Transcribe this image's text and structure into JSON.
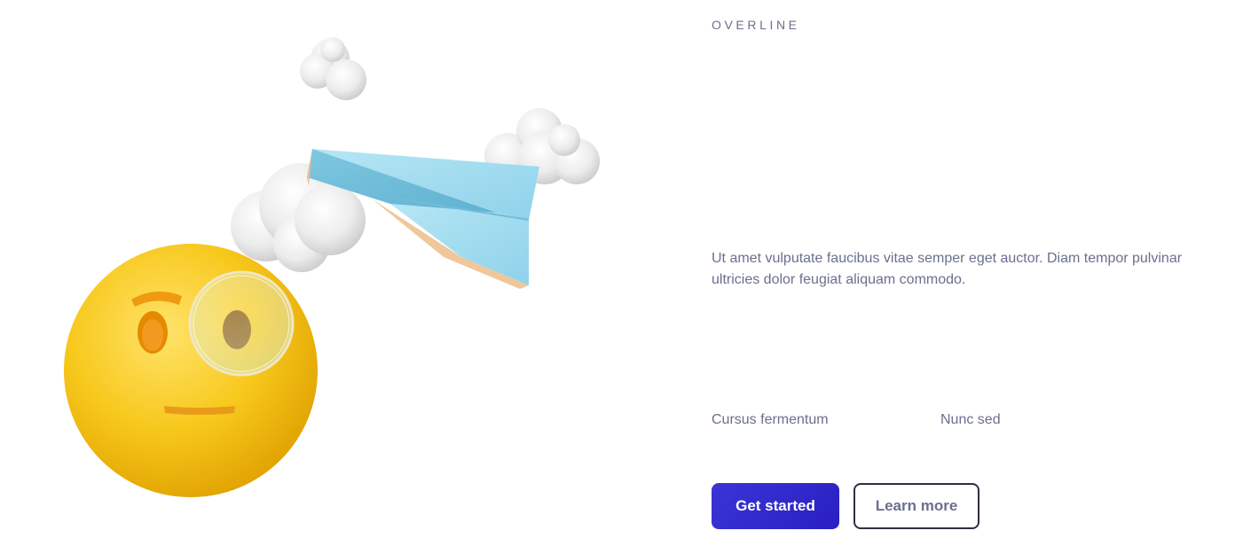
{
  "hero": {
    "overline": "OVERLINE",
    "body_line_1": "Ut amet vulputate faucibus vitae semper eget auctor. Diam tempor pulvinar",
    "body_line_2": "ultricies dolor feugiat aliquam commodo.",
    "features": [
      "Cursus fermentum",
      "Nunc sed"
    ],
    "primary_button": "Get started",
    "secondary_button": "Learn more"
  },
  "illustration": {
    "objects": [
      "emoji-face-with-monocle",
      "paper-plane",
      "cloud",
      "cloud",
      "cloud"
    ]
  },
  "colors": {
    "text_muted": "#6b6f8e",
    "primary": "#2f28cc",
    "outline": "#2c2f45",
    "emoji_yellow": "#f5c518",
    "plane_blue": "#a8dff0"
  }
}
